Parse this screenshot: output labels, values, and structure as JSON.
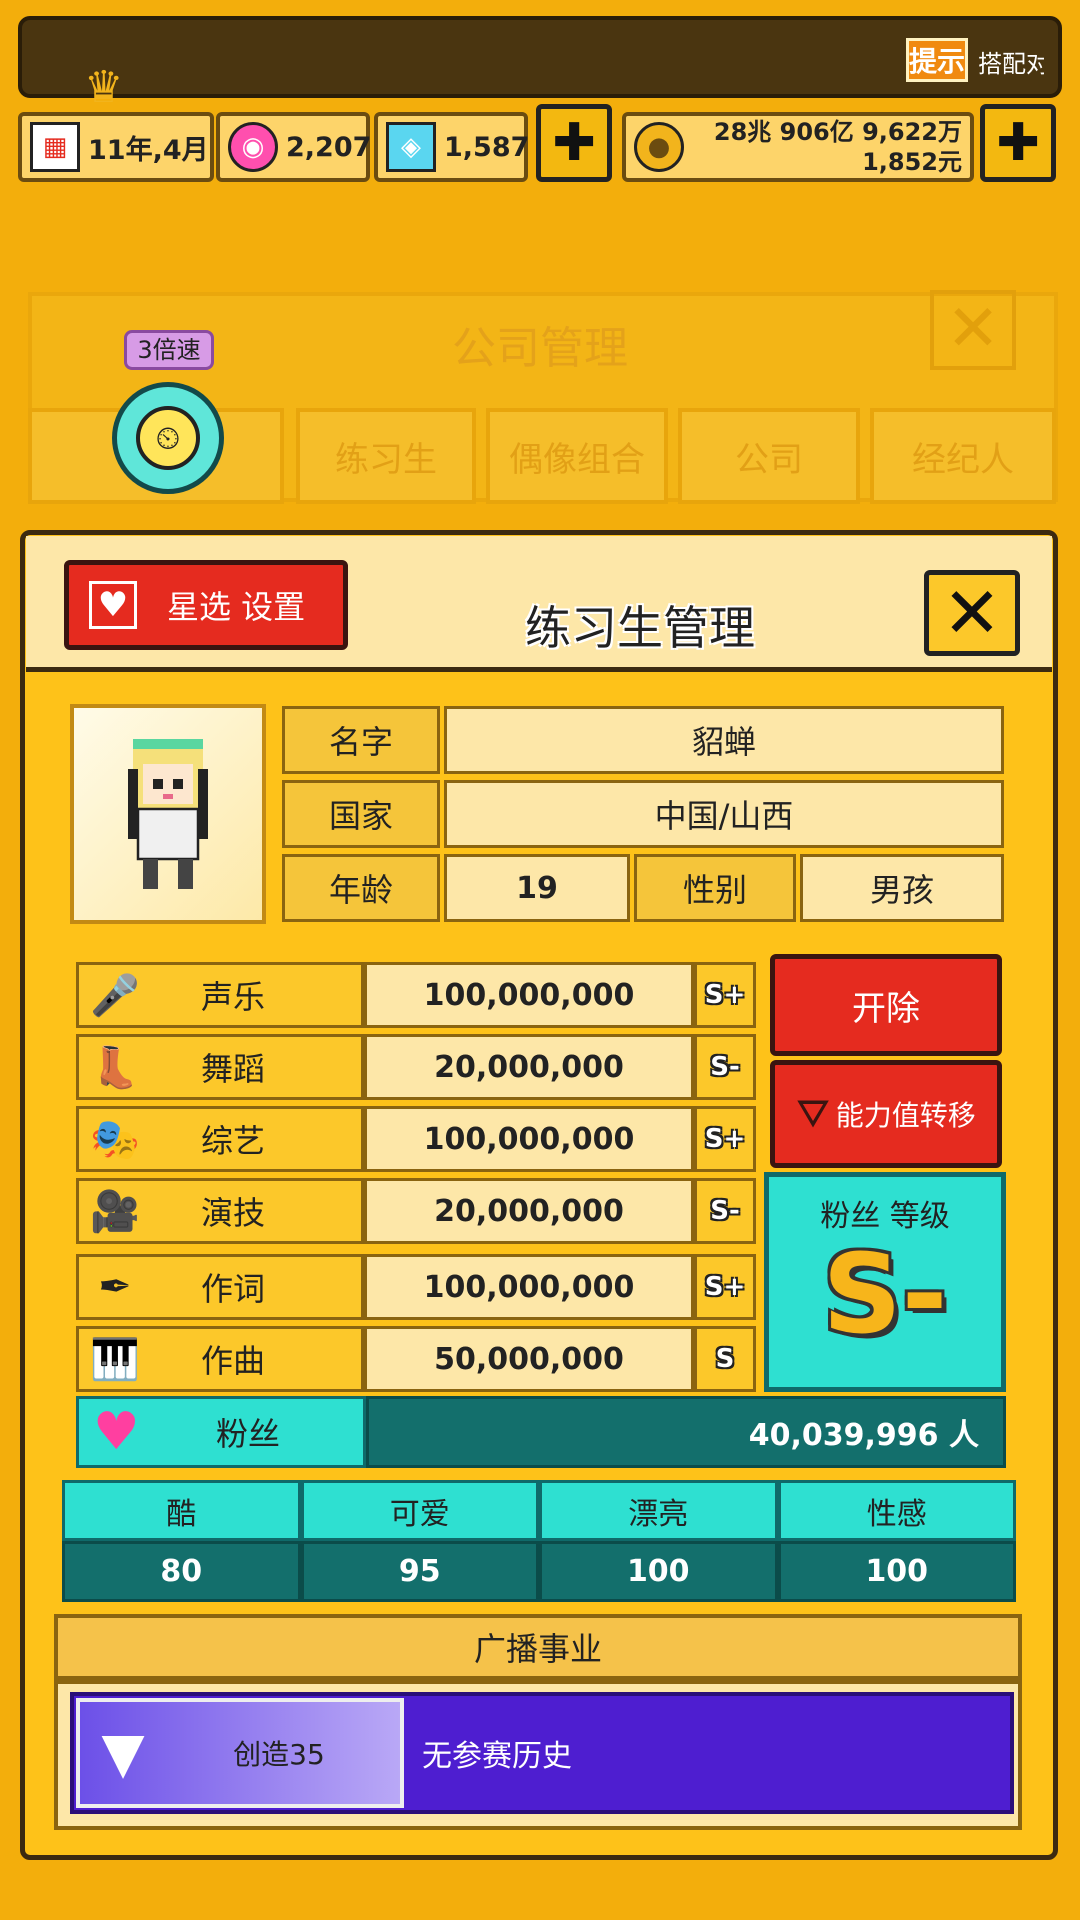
{
  "topbar": {
    "tip_label": "提示",
    "tip_text": "搭配对"
  },
  "stats": {
    "date": "11年,4月",
    "date_icon": "calendar-icon",
    "pink_gems": "2,207",
    "blue_gems": "1,587",
    "money_line1": "28兆 906亿 9,622万",
    "money_line2": "1,852元"
  },
  "background_panel": {
    "title": "公司管理",
    "tabs": [
      "练习生",
      "偶像组合",
      "公司",
      "经纪人"
    ],
    "speed_badge": "3倍速"
  },
  "panel": {
    "star_button": "星选 设置",
    "title": "练习生管理",
    "close": "✕"
  },
  "profile": {
    "name_label": "名字",
    "name": "貂蝉",
    "country_label": "国家",
    "country": "中国/山西",
    "age_label": "年龄",
    "age": "19",
    "gender_label": "性别",
    "gender": "男孩"
  },
  "skills": [
    {
      "name": "声乐",
      "value": "100,000,000",
      "grade": "S+",
      "icon": "microphone-icon",
      "glyph": "🎤"
    },
    {
      "name": "舞蹈",
      "value": "20,000,000",
      "grade": "S-",
      "icon": "boot-icon",
      "glyph": "👢"
    },
    {
      "name": "综艺",
      "value": "100,000,000",
      "grade": "S+",
      "icon": "mask-icon",
      "glyph": "🎭"
    },
    {
      "name": "演技",
      "value": "20,000,000",
      "grade": "S-",
      "icon": "camera-icon",
      "glyph": "🎥"
    },
    {
      "name": "作词",
      "value": "100,000,000",
      "grade": "S+",
      "icon": "pen-icon",
      "glyph": "✒"
    },
    {
      "name": "作曲",
      "value": "50,000,000",
      "grade": "S",
      "icon": "piano-icon",
      "glyph": "🎹"
    }
  ],
  "actions": {
    "fire": "开除",
    "transfer": "能力值转移"
  },
  "fan_grade": {
    "label": "粉丝 等级",
    "grade": "S-"
  },
  "fans": {
    "label": "粉丝",
    "value": "40,039,996 人"
  },
  "attributes": [
    {
      "name": "酷",
      "value": "80"
    },
    {
      "name": "可爱",
      "value": "95"
    },
    {
      "name": "漂亮",
      "value": "100"
    },
    {
      "name": "性感",
      "value": "100"
    }
  ],
  "broadcast": {
    "title": "广播事业",
    "program": "创造35",
    "history": "无参赛历史"
  },
  "colors": {
    "accent": "#f3ae0c",
    "red": "#e52b1f",
    "teal": "#2ee0d1",
    "purple": "#4e1ed0"
  }
}
